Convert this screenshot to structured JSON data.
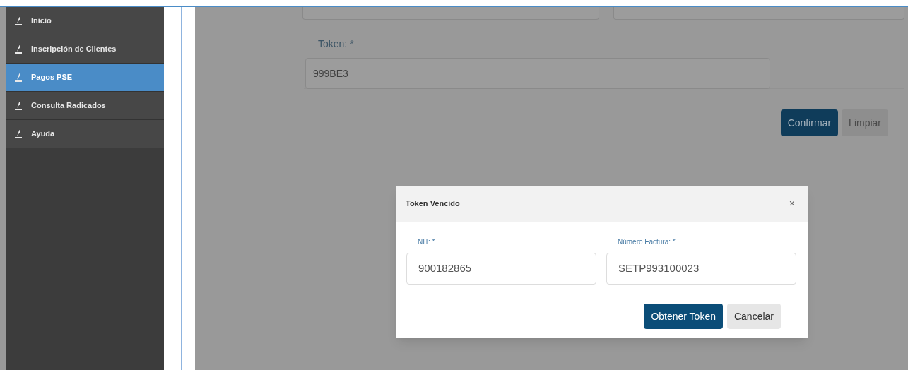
{
  "sidebar": {
    "items": [
      {
        "label": "Inicio",
        "selected": false
      },
      {
        "label": "Inscripción de Clientes",
        "selected": false
      },
      {
        "label": "Pagos PSE",
        "selected": true
      },
      {
        "label": "Consulta Radicados",
        "selected": false
      },
      {
        "label": "Ayuda",
        "selected": false
      }
    ]
  },
  "form": {
    "token_label": "Token: *",
    "token_value": "999BE3",
    "buttons": [
      "Confirmar",
      "Limpiar"
    ]
  },
  "modal": {
    "title": "Token Vencido",
    "close": "×",
    "fields": [
      {
        "label": "NIT: *",
        "value": "900182865"
      },
      {
        "label": "Número Factura: *",
        "value": "SETP993100023"
      }
    ],
    "buttons": [
      "Obtener Token",
      "Cancelar"
    ]
  }
}
